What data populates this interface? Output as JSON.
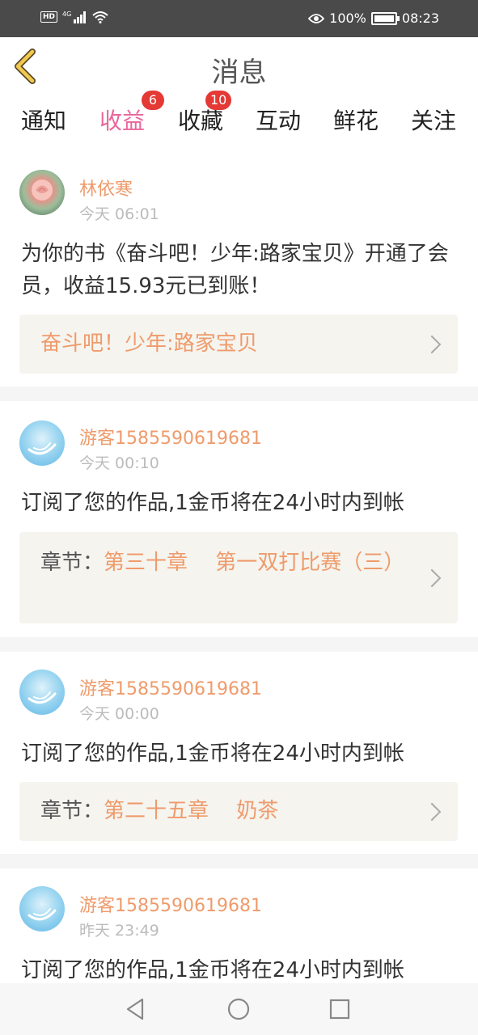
{
  "status_bar": {
    "hd": "HD",
    "network": "4G",
    "battery": "100%",
    "time": "08:23"
  },
  "header": {
    "title": "消息"
  },
  "tabs": [
    {
      "label": "通知",
      "badge": "",
      "active": false
    },
    {
      "label": "收益",
      "badge": "6",
      "active": true
    },
    {
      "label": "收藏",
      "badge": "10",
      "active": false
    },
    {
      "label": "互动",
      "badge": "",
      "active": false
    },
    {
      "label": "鲜花",
      "badge": "",
      "active": false
    },
    {
      "label": "关注",
      "badge": "",
      "active": false
    }
  ],
  "messages": [
    {
      "username": "林依寒",
      "time": "今天 06:01",
      "text": "为你的书《奋斗吧！少年:路家宝贝》开通了会员，收益15.93元已到账！",
      "ref_label": "",
      "ref_text": "奋斗吧！少年:路家宝贝"
    },
    {
      "username": "游客1585590619681",
      "time": "今天 00:10",
      "text": "订阅了您的作品,1金币将在24小时内到帐",
      "ref_label": "章节：",
      "ref_text": "第三十章　 第一双打比赛（三）"
    },
    {
      "username": "游客1585590619681",
      "time": "今天 00:00",
      "text": "订阅了您的作品,1金币将在24小时内到帐",
      "ref_label": "章节：",
      "ref_text": "第二十五章　 奶茶"
    },
    {
      "username": "游客1585590619681",
      "time": "昨天 23:49",
      "text": "订阅了您的作品,1金币将在24小时内到帐",
      "ref_label": "",
      "ref_text": ""
    }
  ],
  "colors": {
    "accent": "#e8679a",
    "username": "#ef9b6b",
    "badge": "#e53935",
    "back_arrow": "#f2c94c"
  }
}
